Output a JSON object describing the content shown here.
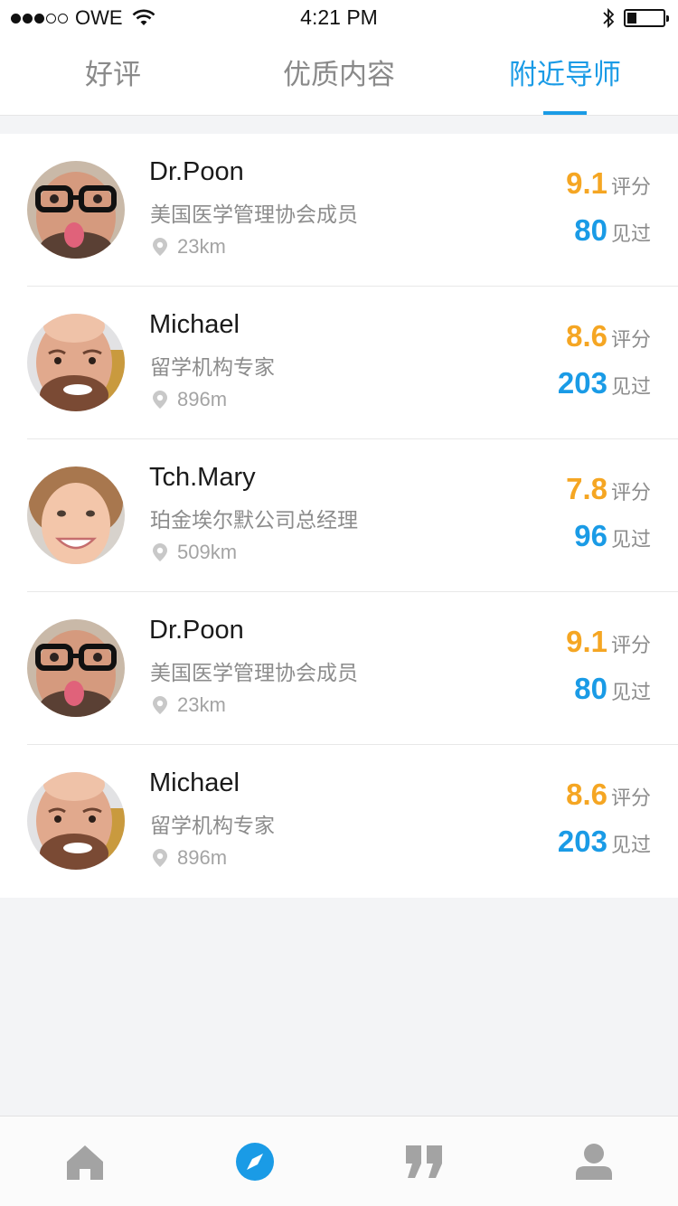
{
  "status_bar": {
    "carrier": "OWE",
    "time": "4:21 PM"
  },
  "tabs": [
    {
      "label": "好评",
      "active": false
    },
    {
      "label": "优质内容",
      "active": false
    },
    {
      "label": "附近导师",
      "active": true
    }
  ],
  "colors": {
    "accent": "#1a9be6",
    "score": "#f5a623"
  },
  "mentors": [
    {
      "name": "Dr.Poon",
      "title": "美国医学管理协会成员",
      "distance": "23km",
      "score": "9.1",
      "score_unit": "评分",
      "met": "80",
      "met_unit": "见过",
      "avatar": "avatar-glasses-tongue"
    },
    {
      "name": "Michael",
      "title": "留学机构专家",
      "distance": "896m",
      "score": "8.6",
      "score_unit": "评分",
      "met": "203",
      "met_unit": "见过",
      "avatar": "avatar-bald-beard"
    },
    {
      "name": "Tch.Mary",
      "title": "珀金埃尔默公司总经理",
      "distance": "509km",
      "score": "7.8",
      "score_unit": "评分",
      "met": "96",
      "met_unit": "见过",
      "avatar": "avatar-woman-smile"
    },
    {
      "name": "Dr.Poon",
      "title": "美国医学管理协会成员",
      "distance": "23km",
      "score": "9.1",
      "score_unit": "评分",
      "met": "80",
      "met_unit": "见过",
      "avatar": "avatar-glasses-tongue"
    },
    {
      "name": "Michael",
      "title": "留学机构专家",
      "distance": "896m",
      "score": "8.6",
      "score_unit": "评分",
      "met": "203",
      "met_unit": "见过",
      "avatar": "avatar-bald-beard"
    }
  ],
  "bottom_nav": [
    {
      "icon": "home-icon",
      "active": false
    },
    {
      "icon": "compass-icon",
      "active": true
    },
    {
      "icon": "quote-icon",
      "active": false
    },
    {
      "icon": "profile-icon",
      "active": false
    }
  ]
}
